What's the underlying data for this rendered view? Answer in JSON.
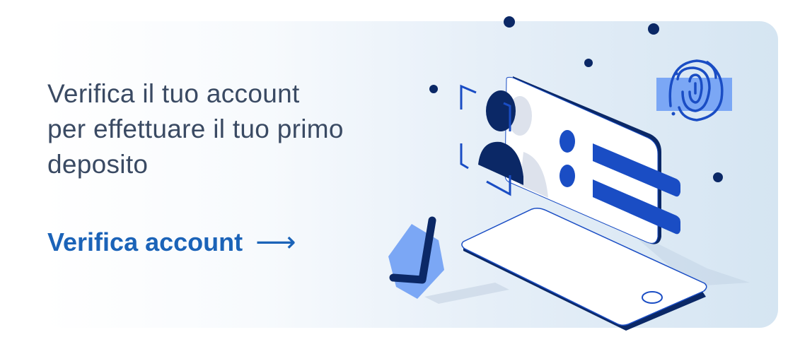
{
  "banner": {
    "headline": "Verifica il tuo account per effettuare il tuo primo deposito",
    "cta_label": "Verifica account",
    "cta_icon": "arrow-right-icon",
    "cta_arrow": "⟶"
  },
  "illustration": {
    "icons": [
      "identity-card-icon",
      "fingerprint-icon",
      "checkmark-icon",
      "smartphone-icon"
    ]
  },
  "colors": {
    "headline": "#3a4a63",
    "cta": "#1b63b8",
    "navy": "#0b2866",
    "blue": "#1a4dc4",
    "light_blue": "#7ba7f5"
  }
}
